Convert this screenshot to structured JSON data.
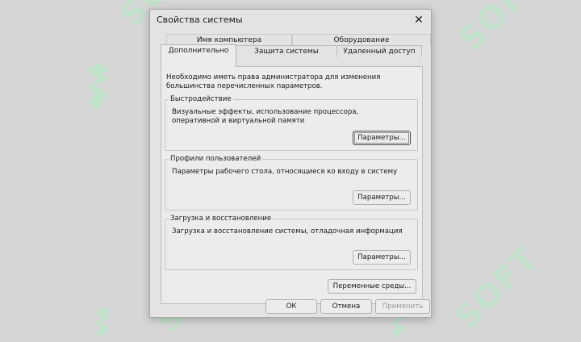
{
  "window": {
    "title": "Свойства системы"
  },
  "tabs": {
    "back_row": [
      "Имя компьютера",
      "Оборудование"
    ],
    "front_row": [
      "Дополнительно",
      "Защита системы",
      "Удаленный доступ"
    ],
    "active": "Дополнительно"
  },
  "panel": {
    "intro": "Необходимо иметь права администратора для изменения большинства перечисленных параметров.",
    "performance": {
      "title": "Быстродействие",
      "description": "Визуальные эффекты, использование процессора, оперативной и виртуальной памяти",
      "button": "Параметры..."
    },
    "profiles": {
      "title": "Профили пользователей",
      "description": "Параметры рабочего стола, относящиеся ко входу в систему",
      "button": "Параметры..."
    },
    "startup": {
      "title": "Загрузка и восстановление",
      "description": "Загрузка и восстановление системы, отладочная информация",
      "button": "Параметры..."
    },
    "env_button": "Переменные среды..."
  },
  "footer": {
    "ok": "ОК",
    "cancel": "Отмена",
    "apply": "Применить"
  },
  "icons": {
    "close": "close-icon"
  },
  "watermark": {
    "text": "SOFT",
    "color": "#bfe3c9"
  }
}
